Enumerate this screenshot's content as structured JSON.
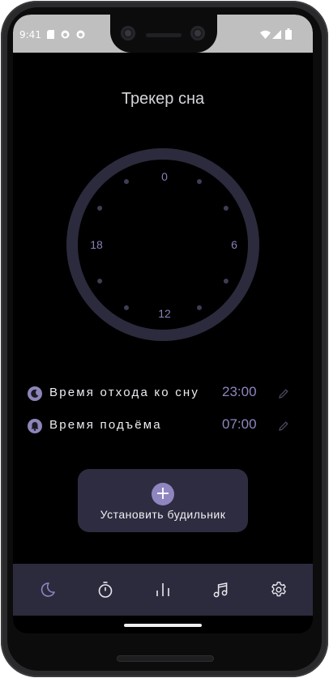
{
  "status_bar": {
    "time": "9:41"
  },
  "header": {
    "title": "Трекер сна"
  },
  "dial": {
    "hour_labels": {
      "top": "0",
      "right": "6",
      "bottom": "12",
      "left": "18"
    }
  },
  "schedule": {
    "bedtime": {
      "label": "Время отхода ко сну",
      "value": "23:00",
      "icon": "moon-icon"
    },
    "wakeup": {
      "label": "Время подъёма",
      "value": "07:00",
      "icon": "bell-icon"
    }
  },
  "alarm_button": {
    "label": "Установить будильник",
    "icon": "plus-icon"
  },
  "nav": {
    "items": [
      {
        "name": "sleep",
        "icon": "moon-icon",
        "active": true
      },
      {
        "name": "timer",
        "icon": "stopwatch-icon",
        "active": false
      },
      {
        "name": "stats",
        "icon": "bar-chart-icon",
        "active": false
      },
      {
        "name": "music",
        "icon": "music-note-icon",
        "active": false
      },
      {
        "name": "settings",
        "icon": "gear-icon",
        "active": false
      }
    ]
  },
  "colors": {
    "accent": "#8f86c0",
    "background": "#000000",
    "dial_ring": "#2c2b3d",
    "navbar": "#2c2b3d",
    "button": "#2e2c40"
  }
}
